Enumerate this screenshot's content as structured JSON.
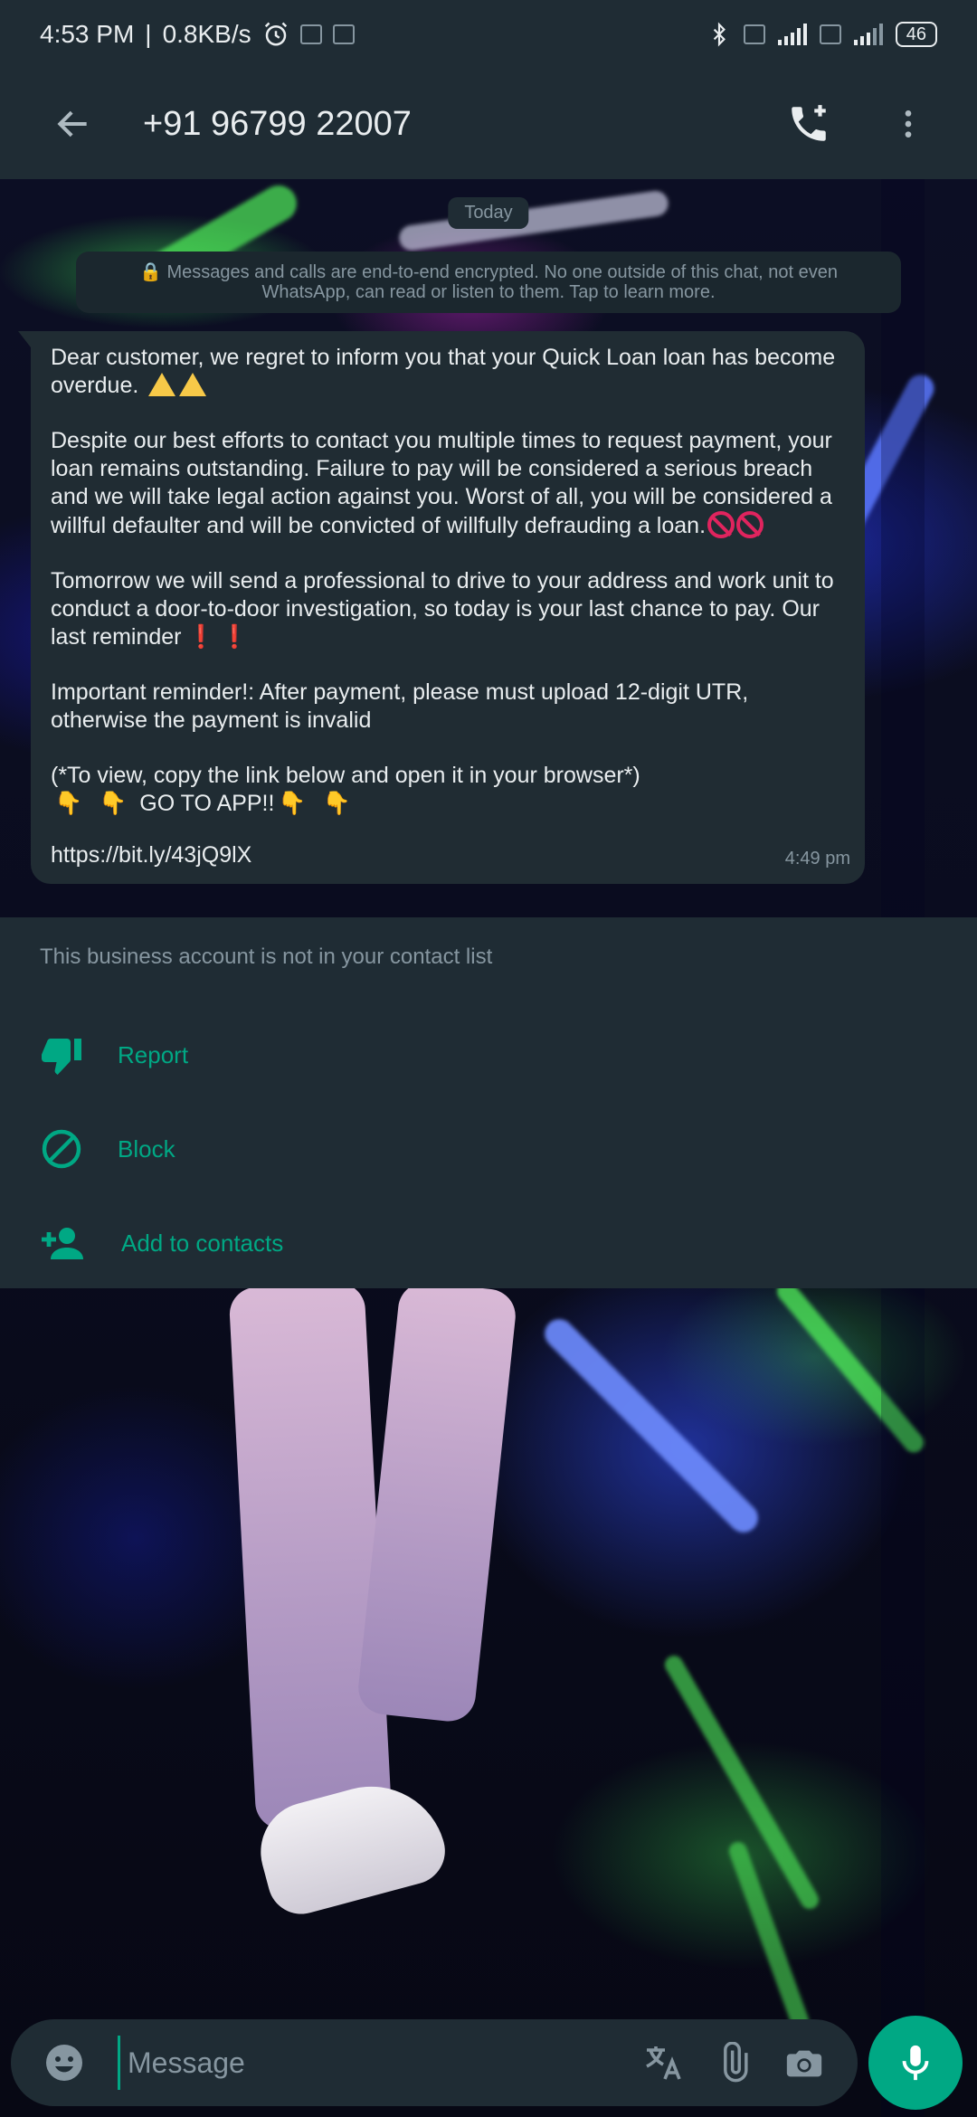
{
  "status_bar": {
    "time": "4:53 PM",
    "net_speed": "0.8KB/s",
    "separator": "|",
    "battery": "46"
  },
  "header": {
    "title": "+91 96799 22007"
  },
  "chat": {
    "date_chip": "Today",
    "encryption_notice": "🔒 Messages and calls are end-to-end encrypted. No one outside of this chat, not even WhatsApp, can read or listen to them. Tap to learn more.",
    "message": {
      "para1": "Dear customer, we regret to inform you that your Quick Loan loan has become overdue.",
      "para2": "Despite our best efforts to contact you multiple times to request payment, your loan remains outstanding. Failure to pay will be considered a serious breach and we will take legal action against you. Worst of all, you will be considered a willful defaulter and will be convicted of willfully defrauding a loan.",
      "para3": "Tomorrow we will send a professional to drive to your address and work unit to conduct a door-to-door investigation, so today is your last chance to pay. Our last reminder",
      "para4": "Important reminder!: After payment, please must upload 12-digit UTR, otherwise the payment is invalid",
      "para5": "(*To view, copy the link below and open it in your browser*)",
      "cta": "GO TO APP!!",
      "link": "https://bit.ly/43jQ9lX",
      "time": "4:49 pm"
    }
  },
  "business_panel": {
    "note": "This business account is not in your contact list",
    "report_label": "Report",
    "block_label": "Block",
    "add_contact_label": "Add to contacts"
  },
  "composer": {
    "placeholder": "Message"
  },
  "colors": {
    "accent": "#00a884",
    "bar_bg": "#1f2c34",
    "bubble_bg": "#202c33",
    "muted_text": "#8696a0"
  }
}
